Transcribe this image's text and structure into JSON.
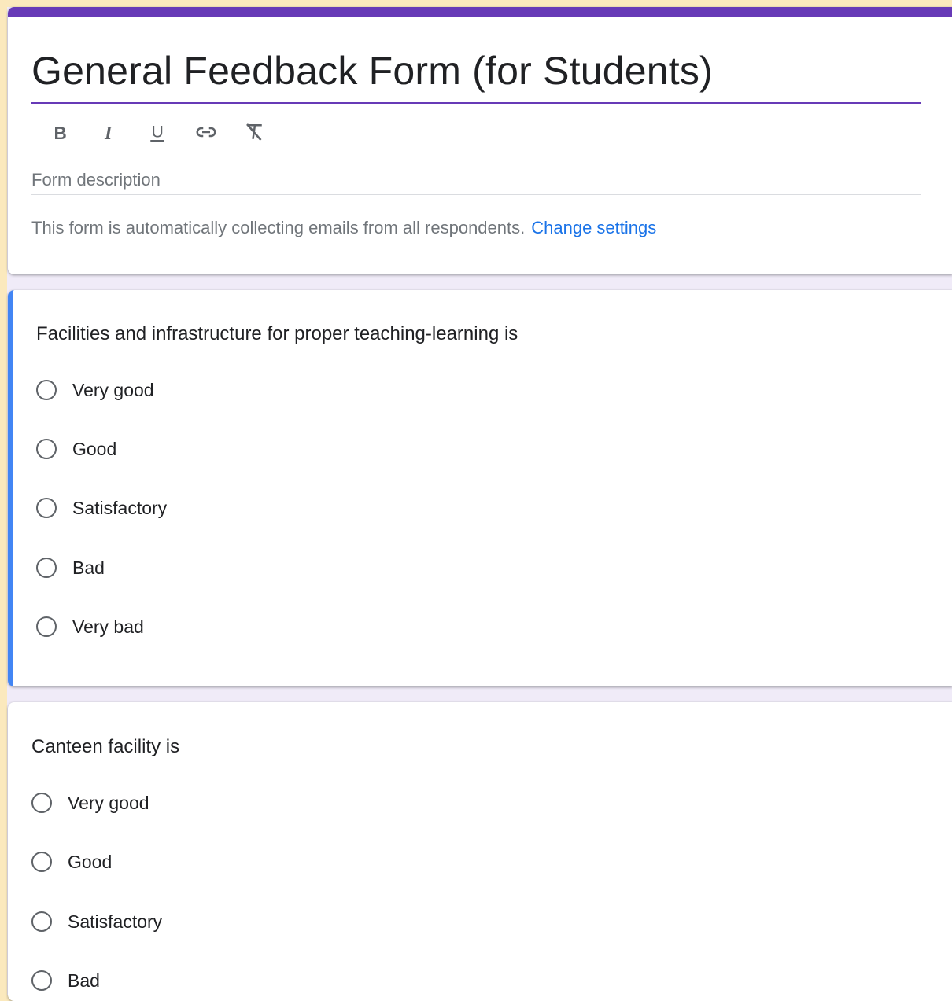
{
  "colors": {
    "theme": "#673ab7",
    "selected_bar": "#4285f4",
    "link": "#1a73e8",
    "page_bg": "#f0ebf8"
  },
  "form": {
    "title": "General Feedback Form (for Students)",
    "description_placeholder": "Form description",
    "email_notice": "This form is automatically collecting emails from all respondents.",
    "change_settings_link": "Change settings"
  },
  "toolbar": {
    "buttons": [
      {
        "label": "B",
        "icon": "bold-icon"
      },
      {
        "label": "I",
        "icon": "italic-icon"
      },
      {
        "label": "U",
        "icon": "underline-icon"
      },
      {
        "icon": "link-icon"
      },
      {
        "icon": "clear-formatting-icon"
      }
    ]
  },
  "questions": [
    {
      "title": "Facilities and infrastructure for proper teaching-learning is",
      "options": [
        "Very good",
        "Good",
        "Satisfactory",
        "Bad",
        "Very bad"
      ]
    },
    {
      "title": "Canteen facility is",
      "options": [
        "Very good",
        "Good",
        "Satisfactory",
        "Bad"
      ]
    }
  ]
}
